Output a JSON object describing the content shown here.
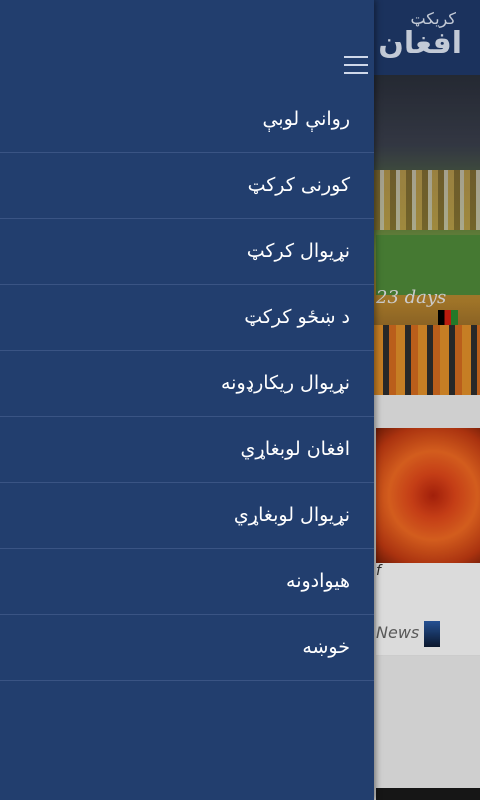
{
  "app": {
    "logo_line1": "کریکټ",
    "logo_line2": "افغان",
    "colors": {
      "appbar": "#1f3a6a",
      "drawer": "#223e6e",
      "divider": "#3a5484"
    }
  },
  "background": {
    "photo_caption": "23 days",
    "card_text": "f",
    "news_label": "News"
  },
  "drawer": {
    "menu_icon": "hamburger-icon",
    "items": [
      {
        "label": "روانې لوبې"
      },
      {
        "label": "کورنی کرکټ"
      },
      {
        "label": "نړیوال کرکټ"
      },
      {
        "label": "د ښځو کرکټ"
      },
      {
        "label": "نړیوال ریکارډونه"
      },
      {
        "label": "افغان لوبغاړي"
      },
      {
        "label": "نړیوال لوبغاړي"
      },
      {
        "label": "هیوادونه"
      },
      {
        "label": "خوښه"
      }
    ]
  }
}
